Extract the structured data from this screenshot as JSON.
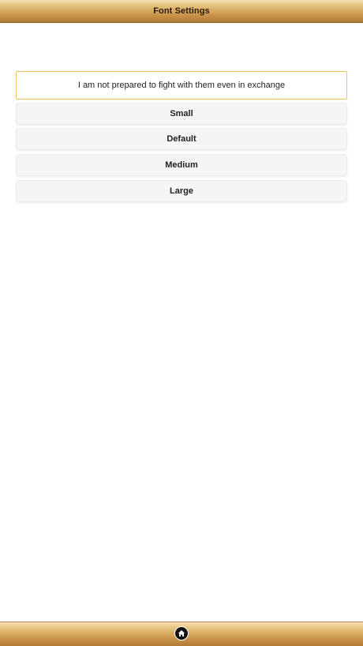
{
  "header": {
    "title": "Font Settings"
  },
  "preview": {
    "text": "I am not prepared to fight with them even in exchange"
  },
  "size_options": [
    {
      "label": "Small"
    },
    {
      "label": "Default"
    },
    {
      "label": "Medium"
    },
    {
      "label": "Large"
    }
  ],
  "footer": {
    "home_icon": "home-icon"
  },
  "colors": {
    "bar_gradient_top": "#f4dfb4",
    "bar_gradient_bottom": "#b07a34",
    "preview_border": "#f3c45a",
    "button_bg": "#f5f5f5"
  }
}
